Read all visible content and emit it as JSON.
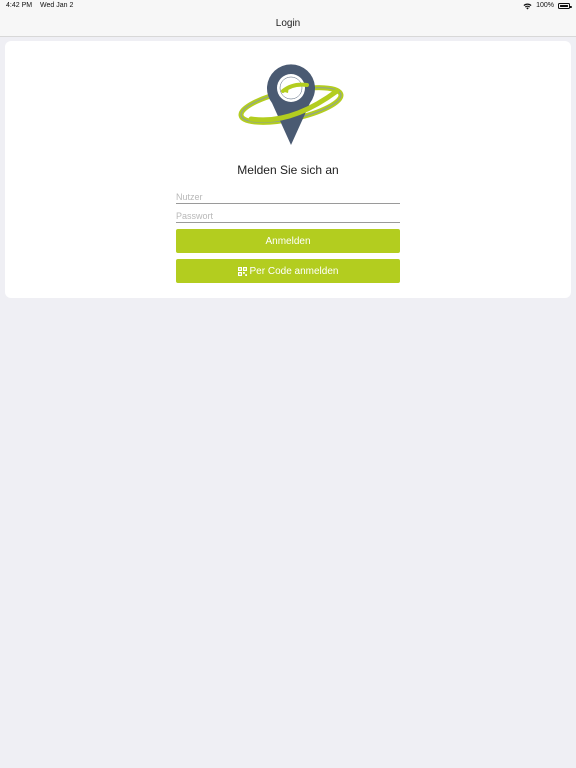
{
  "status_bar": {
    "time": "4:42 PM",
    "date": "Wed Jan 2",
    "battery": "100%",
    "wifi_icon": "wifi-icon",
    "battery_icon": "battery-icon"
  },
  "nav": {
    "title": "Login"
  },
  "login": {
    "heading": "Melden Sie sich an",
    "username_placeholder": "Nutzer",
    "password_placeholder": "Passwort",
    "login_button": "Anmelden",
    "code_button": "Per Code anmelden",
    "code_icon": "qr-code-icon"
  },
  "colors": {
    "accent": "#b3cd1f",
    "logo_pin": "#4a5a72",
    "background": "#efeff4"
  }
}
